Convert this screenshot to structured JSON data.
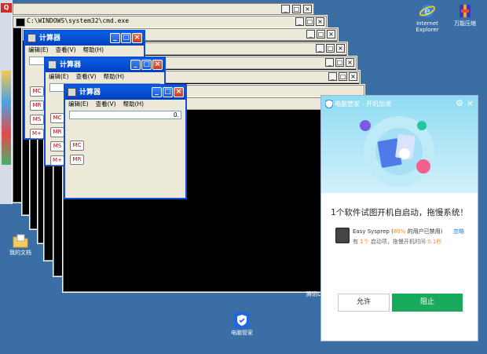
{
  "desktop": {
    "icons": [
      {
        "name": "internet-explorer",
        "label_line1": "Internet",
        "label_line2": "Explorer"
      },
      {
        "name": "wanneng",
        "label": "万能压缩"
      },
      {
        "name": "my-documents",
        "label": "我的文档"
      },
      {
        "name": "diannao-guanjia",
        "label": "电脑管家"
      }
    ],
    "partial_label": "腾讯C",
    "left_label": "Q"
  },
  "cmd": {
    "title": "C:\\WINDOWS\\system32\\cmd.exe"
  },
  "calc": {
    "title": "计算器",
    "menu": [
      "编辑(E)",
      "查看(V)",
      "帮助(H)"
    ],
    "display": "0.",
    "buttons": [
      "MC",
      "MR",
      "MS",
      "M+"
    ]
  },
  "guard": {
    "header_title": "电脑管家 - 开机加速",
    "message": "1个软件试图开机自启动，拖慢系统！",
    "app_name": "Easy Sysprep (",
    "percent": "80%",
    "disabled_text": " 的用户已禁用)",
    "ignore": "忽略",
    "startup_prefix": "有 ",
    "startup_count": "1个",
    "startup_mid": " 启动项，拖慢开机时间 ",
    "startup_time": "0.1秒",
    "allow": "允许",
    "block": "阻止"
  },
  "colors": {
    "desktop": "#3a6ea5",
    "accent_green": "#1aaa5c",
    "warning_orange": "#f08c28",
    "title_blue": "#0a5fe3"
  }
}
